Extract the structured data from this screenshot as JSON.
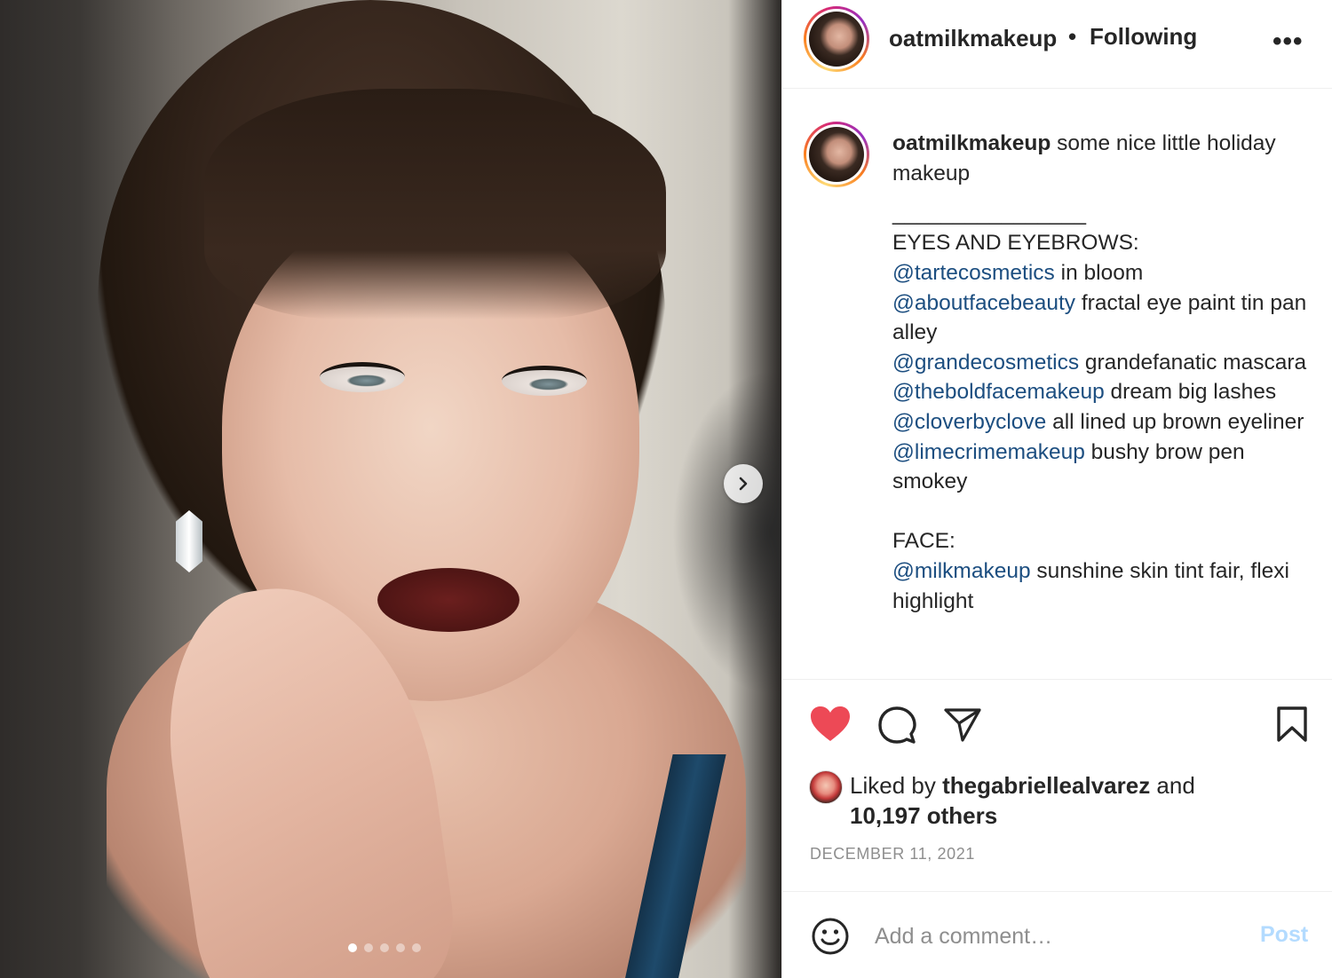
{
  "post": {
    "username": "oatmilkmakeup",
    "separator": "•",
    "follow_status": "Following",
    "more_icon": "more-horizontal-icon",
    "media": {
      "carousel_count": 5,
      "active_index": 0,
      "next_icon": "chevron-right-icon"
    },
    "caption": {
      "username": "oatmilkmakeup",
      "intro": " some nice little holiday makeup",
      "divider": "________________",
      "sections": [
        {
          "heading": "EYES AND EYEBROWS:",
          "items": [
            {
              "mention": "@tartecosmetics",
              "text": " in bloom"
            },
            {
              "mention": "@aboutfacebeauty",
              "text": " fractal eye paint tin pan alley"
            },
            {
              "mention": "@grandecosmetics",
              "text": " grandefanatic mascara"
            },
            {
              "mention": "@theboldfacemakeup",
              "text": " dream big lashes"
            },
            {
              "mention": "@cloverbyclove",
              "text": " all lined up brown eyeliner"
            },
            {
              "mention": "@limecrimemakeup",
              "text": " bushy brow pen smokey"
            }
          ]
        },
        {
          "heading": "FACE:",
          "items": [
            {
              "mention": "@milkmakeup",
              "text": " sunshine skin tint fair, flexi highlight"
            }
          ]
        }
      ]
    },
    "actions": {
      "like_icon": "heart-filled-icon",
      "comment_icon": "comment-icon",
      "share_icon": "paper-plane-icon",
      "save_icon": "bookmark-icon"
    },
    "likes": {
      "prefix": "Liked by ",
      "liker": "thegabriellealvarez",
      "middle": " and",
      "count": "10,197 others"
    },
    "date": "DECEMBER 11, 2021",
    "comment": {
      "emoji_icon": "smiley-icon",
      "placeholder": "Add a comment…",
      "post_label": "Post"
    }
  },
  "colors": {
    "heart": "#ed4956",
    "mention": "#1c4e80",
    "post_disabled": "#b3dbff",
    "muted": "#8e8e8e"
  }
}
